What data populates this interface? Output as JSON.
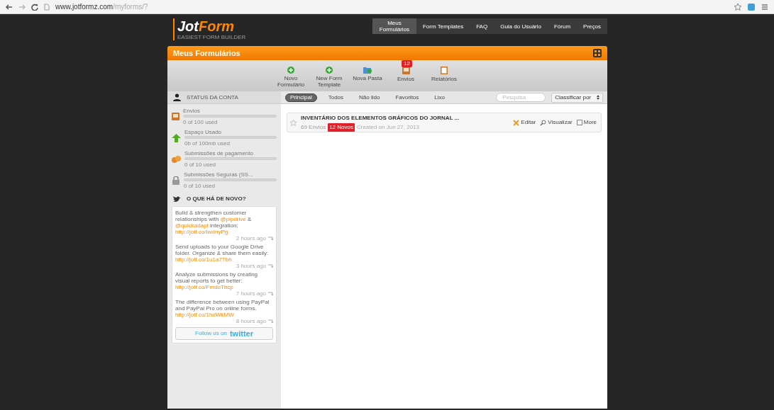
{
  "browser": {
    "url_host": "www.jotformz.com",
    "url_path": "/myforms/?"
  },
  "logo": {
    "name": "JotForm",
    "tagline": "EASIEST FORM BUILDER"
  },
  "nav": [
    {
      "label": "Meus Formulários",
      "selected": true
    },
    {
      "label": "Form Templates",
      "selected": false
    },
    {
      "label": "FAQ",
      "selected": false
    },
    {
      "label": "Guia do Usuário",
      "selected": false
    },
    {
      "label": "Fórum",
      "selected": false
    },
    {
      "label": "Preços",
      "selected": false
    }
  ],
  "panel_title": "Meus Formulários",
  "toolbar": [
    {
      "label": "Novo Formulário",
      "kind": "add"
    },
    {
      "label": "New Form Template",
      "kind": "add"
    },
    {
      "label": "Nova Pasta",
      "kind": "folder"
    },
    {
      "label": "Envios",
      "kind": "inbox",
      "badge": "12"
    },
    {
      "label": "Relatórios",
      "kind": "report"
    }
  ],
  "account": {
    "title": "STATUS DA CONTA",
    "items": [
      {
        "label": "Envios",
        "usage": "0 of 100 used",
        "level": 0,
        "kind": "inbox"
      },
      {
        "label": "Espaço Usado",
        "usage": "0b of 100mb used",
        "level": 0,
        "kind": "upload"
      },
      {
        "label": "Submissões de pagamento",
        "usage": "0 of 10 used",
        "level": 0,
        "kind": "coins"
      },
      {
        "label": "Submissões Seguras (SS...",
        "usage": "0 of 10 used",
        "level": 0,
        "kind": "lock"
      }
    ]
  },
  "news": {
    "title": "O QUE HÁ DE NOVO?",
    "tweets": [
      {
        "text": "Build & strengthen customer relationships with ",
        "link_parts": [
          "@pipdrive",
          "@quickadapt"
        ],
        "mid": " & ",
        "after": " integration: ",
        "url": "http://jotf.co/IwdnyPg",
        "time": "2 hours ago"
      },
      {
        "text": "Send uploads to your Google Drive folder. Organize & share them easily: ",
        "url": "http://jotf.co/1u1a7Tbh",
        "time": "3 hours ago"
      },
      {
        "text": "Analyze submissions by creating visual reports to get better: ",
        "url": "http://jotf.co/FmdoTbcp",
        "time": "7 hours ago"
      },
      {
        "text": "The difference between using PayPal and PayPal Pro on online forms. ",
        "url": "http://jotf.co/1hdWkMW",
        "time": "8 hours ago"
      }
    ],
    "follow": "Follow us on",
    "brand": "twitter"
  },
  "filters": [
    {
      "label": "Principal",
      "selected": true
    },
    {
      "label": "Todos",
      "selected": false
    },
    {
      "label": "Não lido",
      "selected": false
    },
    {
      "label": "Favoritos",
      "selected": false
    },
    {
      "label": "Lixo",
      "selected": false
    }
  ],
  "search": {
    "placeholder": "Pesquisa"
  },
  "sort": {
    "label": "Classificar por"
  },
  "forms": [
    {
      "title": "INVENTÁRIO DOS ELEMENTOS GRÁFICOS DO JORNAL ...",
      "count": "69 Envios",
      "new_badge": "12 Novos",
      "created": "Created on Jun 27, 2013",
      "starred": false
    }
  ],
  "actions": [
    {
      "label": "Editar",
      "kind": "edit"
    },
    {
      "label": "Visualizar",
      "kind": "view"
    },
    {
      "label": "More",
      "kind": "more"
    }
  ]
}
